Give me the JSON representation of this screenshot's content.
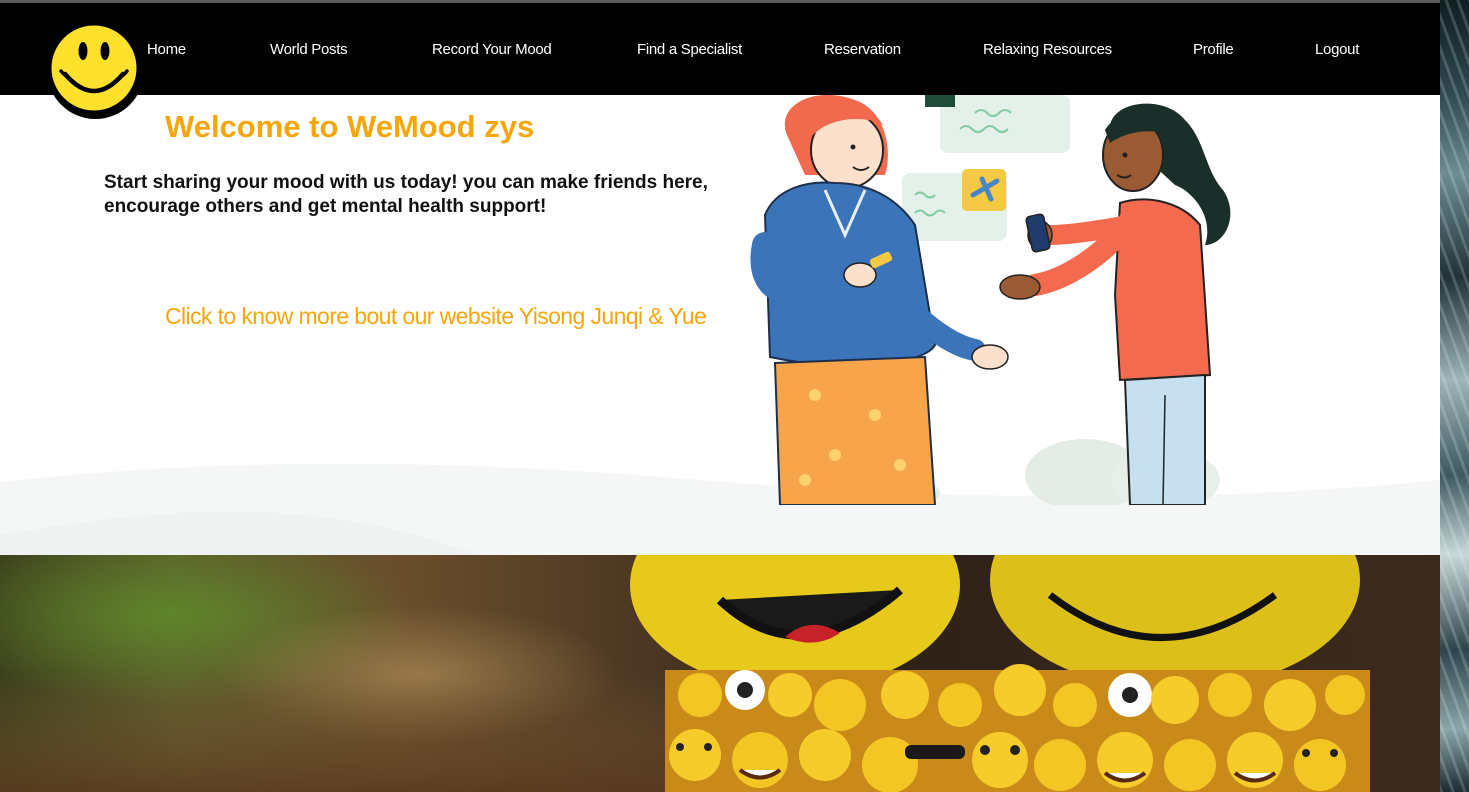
{
  "nav": {
    "items": [
      {
        "label": "Home"
      },
      {
        "label": "World Posts"
      },
      {
        "label": "Record Your Mood"
      },
      {
        "label": "Find a Specialist"
      },
      {
        "label": "Reservation"
      },
      {
        "label": "Relaxing Resources"
      },
      {
        "label": "Profile"
      },
      {
        "label": "Logout"
      }
    ]
  },
  "hero": {
    "title": "Welcome to WeMood zys",
    "text": "Start sharing your mood with us today! you can make friends here, encourage others and get mental health support!",
    "link": "Click to know more bout our website Yisong Junqi & Yue"
  },
  "colors": {
    "accent": "#f5a60b",
    "navbar": "#000000",
    "smiley_yellow": "#fde12c"
  },
  "icons": {
    "logo": "smiley-face-icon"
  }
}
